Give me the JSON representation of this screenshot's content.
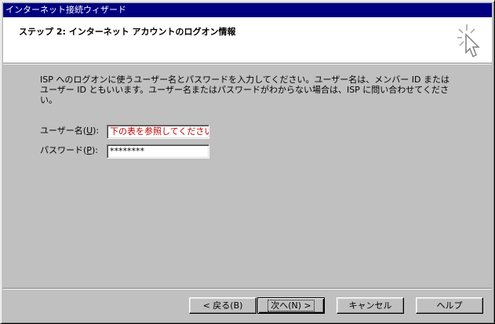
{
  "window": {
    "title": "インターネット接続ウィザード"
  },
  "header": {
    "step_title": "ステップ 2: インターネット アカウントのログオン情報",
    "icon": "wizard-cursor-icon"
  },
  "main": {
    "description": "ISP へのログオンに使うユーザー名とパスワードを入力してください。ユーザー名は、メンバー ID またはユーザー ID ともいいます。ユーザー名またはパスワードがわからない場合は、ISP に問い合わせてください。",
    "username": {
      "label": "ユーザー名(",
      "accel": "U",
      "label_end": "):",
      "value": "下の表を参照してください"
    },
    "password": {
      "label": "パスワード(",
      "accel": "P",
      "label_end": "):",
      "value": "********"
    }
  },
  "buttons": {
    "back": "< 戻る(B)",
    "next": "次へ(N) >",
    "cancel": "キャンセル",
    "help": "ヘルプ"
  },
  "colors": {
    "titlebar": "#000080",
    "face": "#c0c0c0",
    "username_text": "#c00000"
  }
}
